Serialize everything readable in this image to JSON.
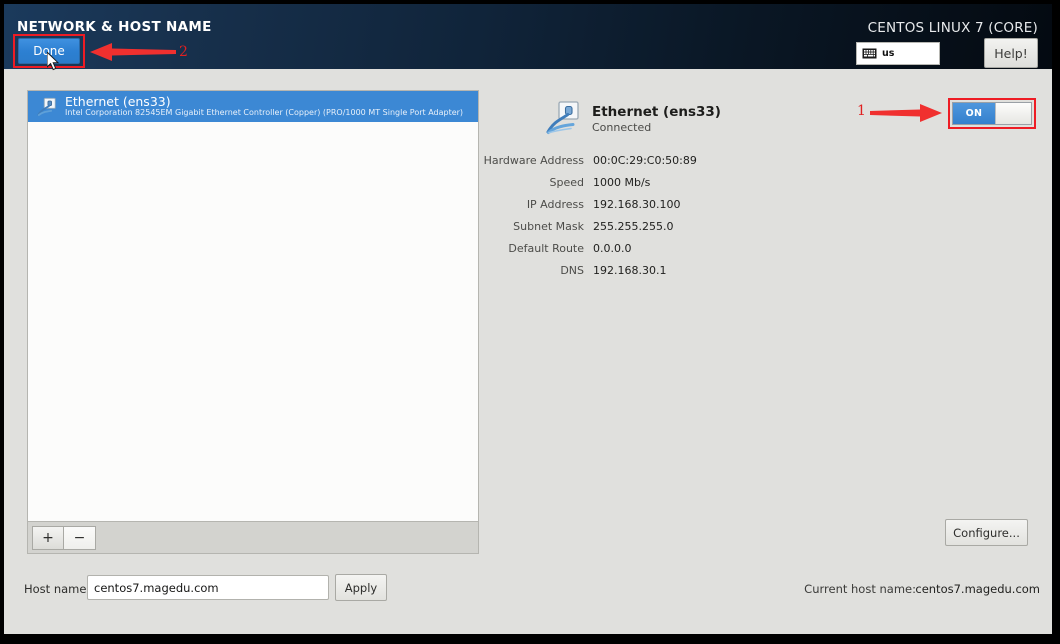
{
  "header": {
    "title": "NETWORK & HOST NAME",
    "distro": "CENTOS LINUX 7 (CORE)",
    "done_label": "Done",
    "keyboard_layout": "us",
    "help_label": "Help!"
  },
  "annotations": {
    "one": "1",
    "two": "2",
    "accent_color": "#ee1c24"
  },
  "device_list": {
    "items": [
      {
        "name": "Ethernet (ens33)",
        "description": "Intel Corporation 82545EM Gigabit Ethernet Controller (Copper) (PRO/1000 MT Single Port Adapter)",
        "icon": "wired-network-icon",
        "selected": true
      }
    ],
    "add_label": "+",
    "remove_label": "−"
  },
  "detail": {
    "name": "Ethernet (ens33)",
    "status": "Connected",
    "icon": "wired-network-icon",
    "toggle_state": "ON",
    "rows": [
      {
        "key": "Hardware Address",
        "value": "00:0C:29:C0:50:89"
      },
      {
        "key": "Speed",
        "value": "1000 Mb/s"
      },
      {
        "key": "IP Address",
        "value": "192.168.30.100"
      },
      {
        "key": "Subnet Mask",
        "value": "255.255.255.0"
      },
      {
        "key": "Default Route",
        "value": "0.0.0.0"
      },
      {
        "key": "DNS",
        "value": "192.168.30.1"
      }
    ],
    "configure_label": "Configure..."
  },
  "footer": {
    "hostname_label": "Host name:",
    "hostname_value": "centos7.magedu.com",
    "hostname_placeholder": "",
    "apply_label": "Apply",
    "current_hostname_label": "Current host name:",
    "current_hostname_value": "centos7.magedu.com"
  }
}
